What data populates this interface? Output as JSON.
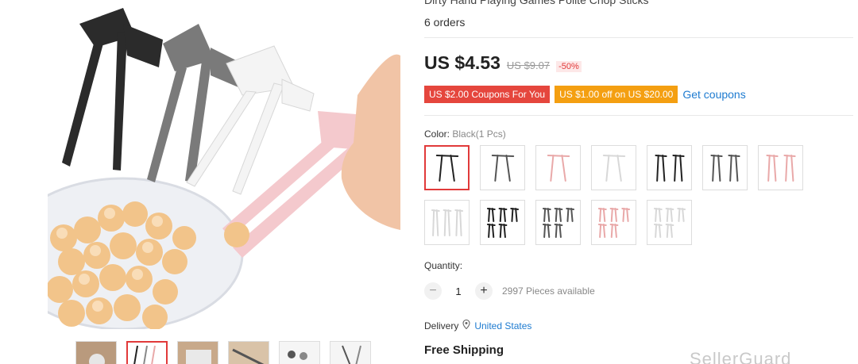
{
  "product": {
    "title": "Dirty Hand Playing Games Polite Chop Sticks",
    "orders": "6 orders"
  },
  "price": {
    "current": "US $4.53",
    "original": "US $9.07",
    "discount": "-50%"
  },
  "coupons": {
    "coupon_1": "US $2.00 Coupons For You",
    "coupon_2": "US $1.00 off on US $20.00",
    "link": "Get coupons"
  },
  "color": {
    "label": "Color:",
    "selected": "Black(1 Pcs)",
    "options": [
      {
        "name": "black-1",
        "color": "#222222",
        "count": 1
      },
      {
        "name": "gray-1",
        "color": "#555555",
        "count": 1
      },
      {
        "name": "pink-1",
        "color": "#e9a9a9",
        "count": 1
      },
      {
        "name": "white-1",
        "color": "#d8d8d8",
        "count": 1
      },
      {
        "name": "black-2",
        "color": "#222222",
        "count": 2
      },
      {
        "name": "gray-2",
        "color": "#555555",
        "count": 2
      },
      {
        "name": "pink-2",
        "color": "#e9a9a9",
        "count": 2
      },
      {
        "name": "white-3",
        "color": "#d8d8d8",
        "count": 3
      },
      {
        "name": "black-5",
        "color": "#222222",
        "count": 5
      },
      {
        "name": "gray-5",
        "color": "#555555",
        "count": 5
      },
      {
        "name": "pink-5",
        "color": "#e9a9a9",
        "count": 5
      },
      {
        "name": "white-5",
        "color": "#d8d8d8",
        "count": 5
      }
    ]
  },
  "quantity": {
    "label": "Quantity:",
    "value": "1",
    "minus": "−",
    "plus": "+",
    "available": "2997 Pieces available"
  },
  "delivery": {
    "label": "Delivery",
    "location": "United States",
    "icon": "location-pin-icon"
  },
  "shipping": {
    "label": "Free Shipping"
  },
  "watermark": "SellerGuard"
}
